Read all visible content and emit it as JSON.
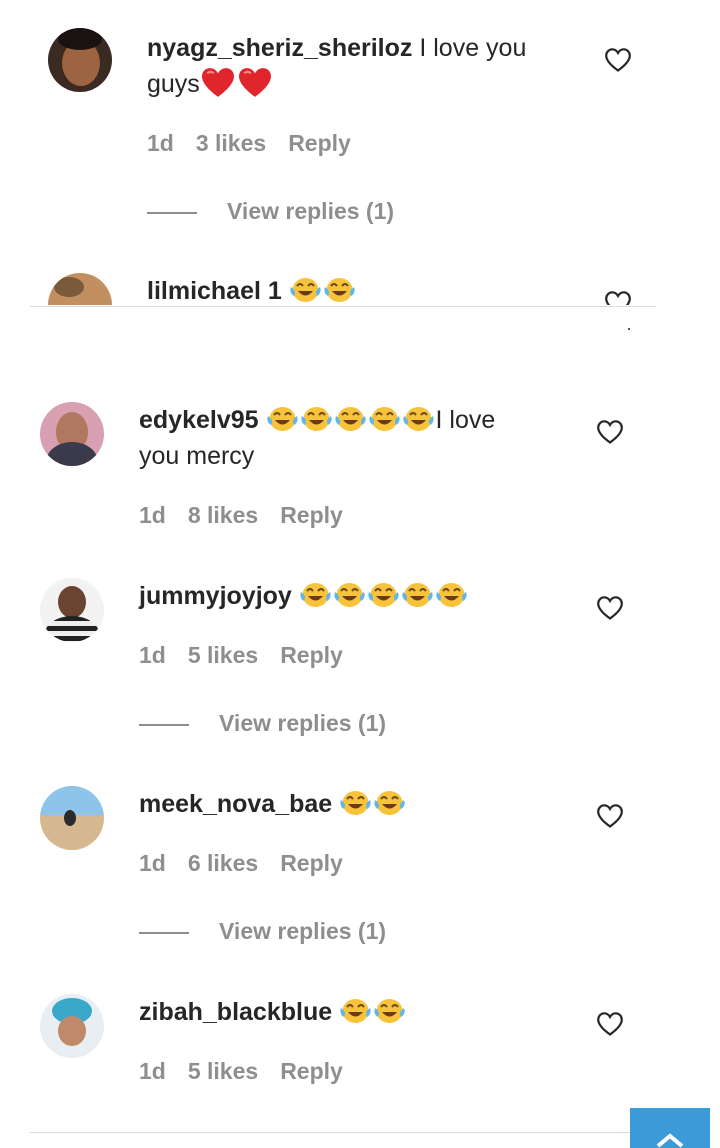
{
  "comments": [
    {
      "username": "nyagz_sheriz_sheriloz",
      "text_pre": "I love you",
      "text_line2": "guys",
      "time": "1d",
      "likes": "3 likes",
      "reply": "Reply",
      "view_replies": "View replies (1)"
    },
    {
      "username": "lilmichael 1"
    },
    {
      "username": "edykelv95",
      "text_after": "I love",
      "text_line2": "you mercy",
      "time": "1d",
      "likes": "8 likes",
      "reply": "Reply"
    },
    {
      "username": "jummyjoyjoy",
      "time": "1d",
      "likes": "5 likes",
      "reply": "Reply",
      "view_replies": "View replies (1)"
    },
    {
      "username": "meek_nova_bae",
      "time": "1d",
      "likes": "6 likes",
      "reply": "Reply",
      "view_replies": "View replies (1)"
    },
    {
      "username": "zibah_blackblue",
      "time": "1d",
      "likes": "5 likes",
      "reply": "Reply"
    }
  ],
  "icons": {
    "heart": "heart-outline-icon",
    "laugh": "face-with-tears-of-joy-emoji",
    "red_heart": "red-heart-emoji"
  },
  "colors": {
    "username": "#262626",
    "meta": "#8e8e8e",
    "scroll_button": "#3d9ad8"
  }
}
